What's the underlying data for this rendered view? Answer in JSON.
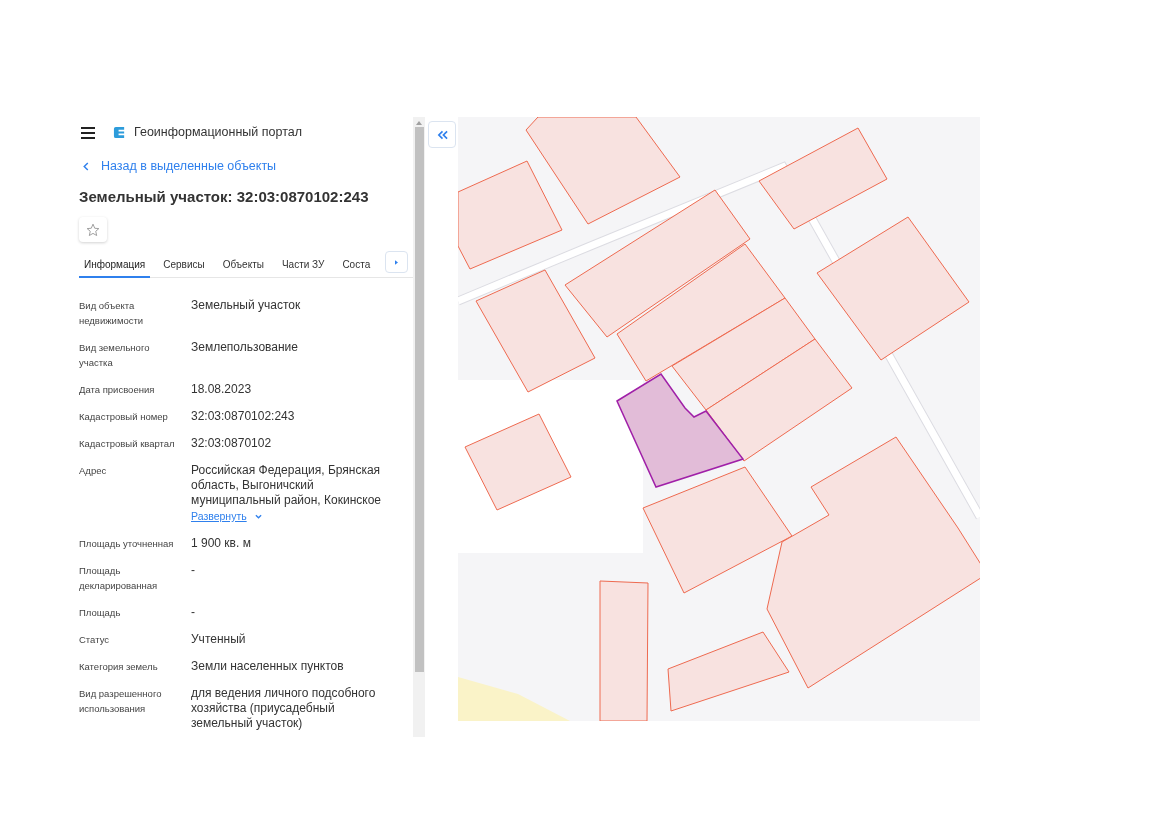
{
  "header": {
    "app_title": "Геоинформационный портал"
  },
  "back_link": "Назад в выделенные объекты",
  "title": "Земельный участок: 32:03:0870102:243",
  "tabs": [
    {
      "label": "Информация",
      "selected": true
    },
    {
      "label": "Сервисы",
      "selected": false
    },
    {
      "label": "Объекты",
      "selected": false
    },
    {
      "label": "Части ЗУ",
      "selected": false
    },
    {
      "label": "Соста",
      "selected": false
    }
  ],
  "properties": [
    {
      "label": "Вид объекта недвижимости",
      "value": "Земельный участок"
    },
    {
      "label": "Вид земельного участка",
      "value": "Землепользование"
    },
    {
      "label": "Дата присвоения",
      "value": "18.08.2023"
    },
    {
      "label": "Кадастровый номер",
      "value": "32:03:0870102:243"
    },
    {
      "label": "Кадастровый квартал",
      "value": "32:03:0870102"
    },
    {
      "label": "Адрес",
      "value": "Российская Федерация, Брянская область, Выгоничский муниципальный район, Кокинское",
      "expand_link": "Развернуть"
    },
    {
      "label": "Площадь уточненная",
      "value": "1 900 кв. м"
    },
    {
      "label": "Площадь декларированная",
      "value": "-"
    },
    {
      "label": "Площадь",
      "value": "-"
    },
    {
      "label": "Статус",
      "value": "Учтенный"
    },
    {
      "label": "Категория земель",
      "value": "Земли населенных пунктов"
    },
    {
      "label": "Вид разрешенного использования",
      "value": "для ведения личного подсобного хозяйства (приусадебный земельный участок)"
    }
  ]
}
